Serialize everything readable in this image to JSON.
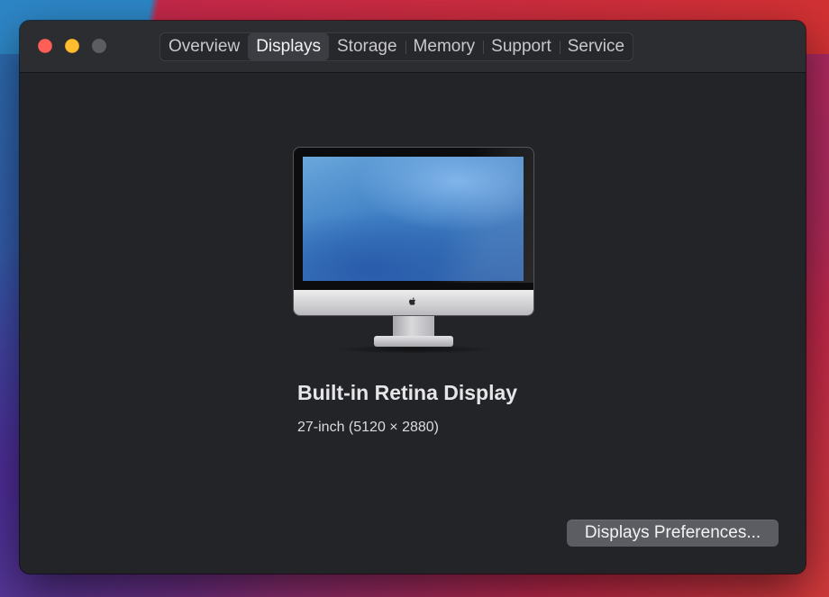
{
  "window": {
    "tabs": [
      {
        "label": "Overview",
        "active": false
      },
      {
        "label": "Displays",
        "active": true
      },
      {
        "label": "Storage",
        "active": false
      },
      {
        "label": "Memory",
        "active": false
      },
      {
        "label": "Support",
        "active": false
      },
      {
        "label": "Service",
        "active": false
      }
    ]
  },
  "display": {
    "name": "Built-in Retina Display",
    "spec": "27-inch (5120 × 2880)",
    "icon": "imac-icon"
  },
  "actions": {
    "preferences_label": "Displays Preferences..."
  },
  "colors": {
    "close": "#ff5f57",
    "minimize": "#febc2e",
    "zoom_disabled": "#5c5d61",
    "window_bg": "#232428",
    "button_bg": "#5c5d62"
  }
}
